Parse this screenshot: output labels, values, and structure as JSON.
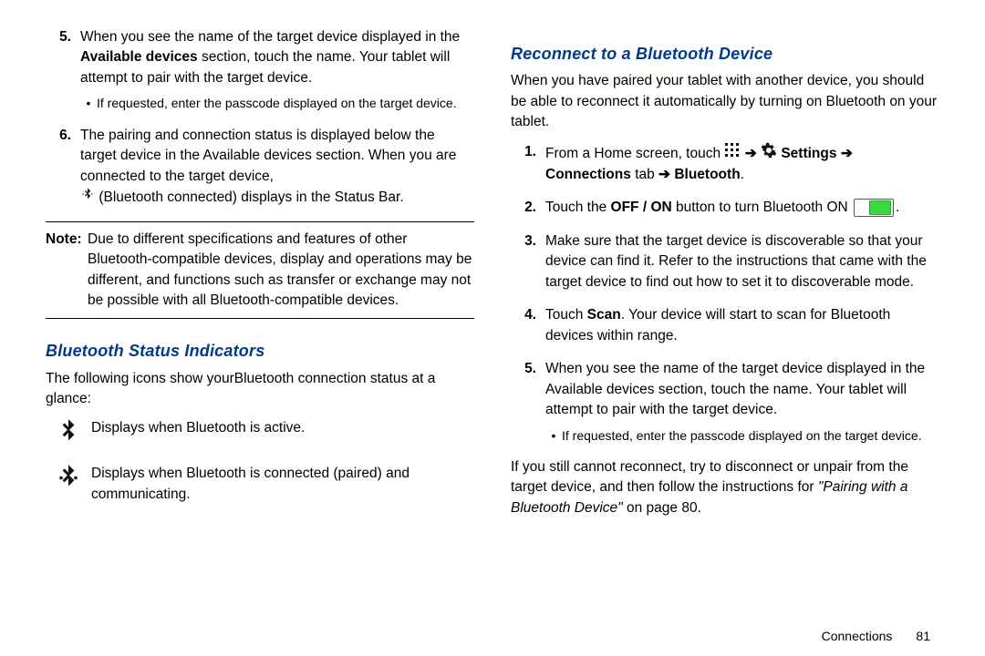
{
  "left": {
    "step5_num": "5.",
    "step5_a": "When you see the name of the target device displayed in the ",
    "step5_bold": "Available devices",
    "step5_b": " section, touch the name. Your tablet will attempt to pair with the target device.",
    "step5_bullet": "If requested, enter the passcode displayed on the target device.",
    "step6_num": "6.",
    "step6_a": "The pairing and connection status is displayed below the target device in the Available devices section. When you are connected to the target device,",
    "step6_b": " (Bluetooth connected) displays in the Status Bar.",
    "note_label": "Note:",
    "note_text": "Due to different specifications and features of other Bluetooth-compatible devices, display and operations may be different, and functions such as transfer or exchange may not be possible with all Bluetooth-compatible devices.",
    "h_indicators": "Bluetooth Status Indicators",
    "indicators_intro": "The following icons show yourBluetooth connection status at a glance:",
    "ind1": "Displays when Bluetooth is active.",
    "ind2": "Displays when Bluetooth is connected (paired) and communicating."
  },
  "right": {
    "h_reconnect": "Reconnect to a Bluetooth Device",
    "intro": "When you have paired your tablet with another device, you should be able to reconnect it automatically by turning on Bluetooth on your tablet.",
    "s1_num": "1.",
    "s1_a": "From a Home screen, touch ",
    "s1_settings": "Settings",
    "s1_conn": "Connections",
    "s1_tab": " tab ",
    "s1_bt": "Bluetooth",
    "s2_num": "2.",
    "s2_a": "Touch the ",
    "s2_offon": "OFF / ON",
    "s2_b": " button to turn Bluetooth ON ",
    "s3_num": "3.",
    "s3": "Make sure that the target device is discoverable so that your device can find it. Refer to the instructions that came with the target device to find out how to set it to discoverable mode.",
    "s4_num": "4.",
    "s4_a": "Touch ",
    "s4_scan": "Scan",
    "s4_b": ". Your device will start to scan for Bluetooth devices within range.",
    "s5_num": "5.",
    "s5": "When you see the name of the target device displayed in the Available devices section, touch the name. Your tablet will attempt to pair with the target device.",
    "s5_bullet": "If requested, enter the passcode displayed on the target device.",
    "out_a": "If you still cannot reconnect, try to disconnect or unpair from the target device, and then follow the instructions for ",
    "out_ref": "\"Pairing with a Bluetooth Device\"",
    "out_b": " on page 80."
  },
  "footer": {
    "section": "Connections",
    "page": "81"
  }
}
